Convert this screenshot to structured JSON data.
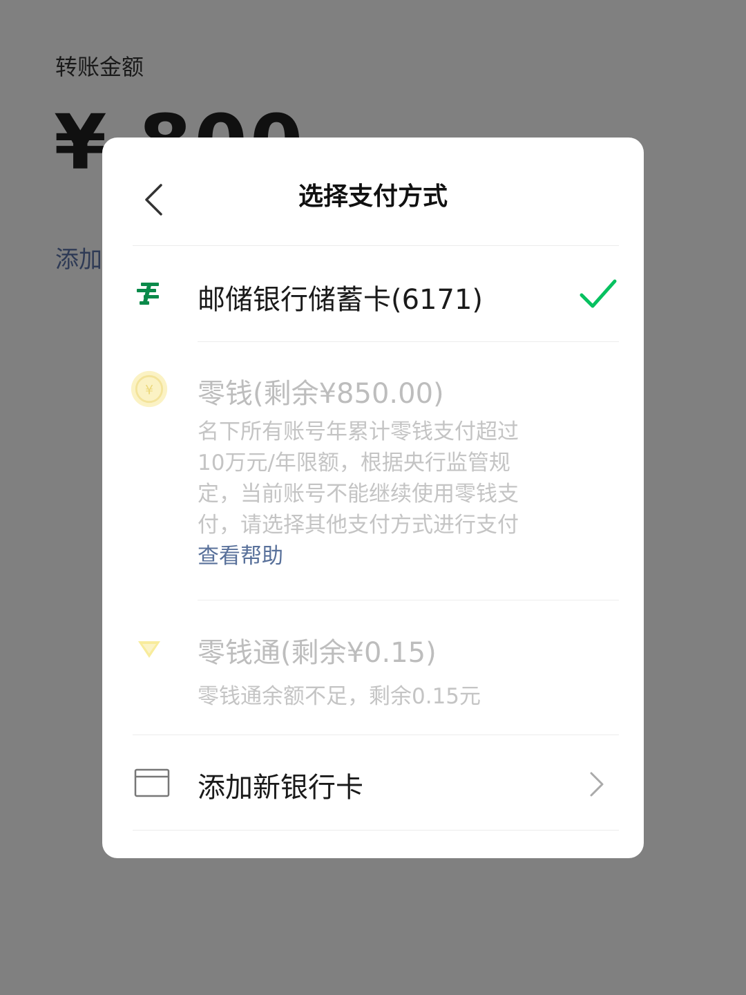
{
  "background": {
    "label": "转账金额",
    "amount": "¥ 800",
    "add_note": "添加"
  },
  "modal": {
    "title": "选择支付方式",
    "options": [
      {
        "title": "邮储银行储蓄卡(6171)",
        "icon": "postal-bank-icon",
        "selected": true
      },
      {
        "title": "零钱(剩余¥850.00)",
        "icon": "coin-icon",
        "desc": "名下所有账号年累计零钱支付超过10万元/年限额，根据央行监管规定，当前账号不能继续使用零钱支付，请选择其他支付方式进行支付",
        "help_link": "查看帮助",
        "disabled": true
      },
      {
        "title": "零钱通(剩余¥0.15)",
        "icon": "lingqiantong-icon",
        "desc": "零钱通余额不足，剩余0.15元",
        "disabled": true
      },
      {
        "title": "添加新银行卡",
        "icon": "bank-card-icon"
      }
    ]
  },
  "colors": {
    "overlay": "#808080",
    "check_green": "#07c160",
    "link_blue": "#58709a",
    "disabled_text": "#bdbdbd",
    "postal_green": "#0a8a4a",
    "coin_yellow": "#f7e9a6"
  }
}
